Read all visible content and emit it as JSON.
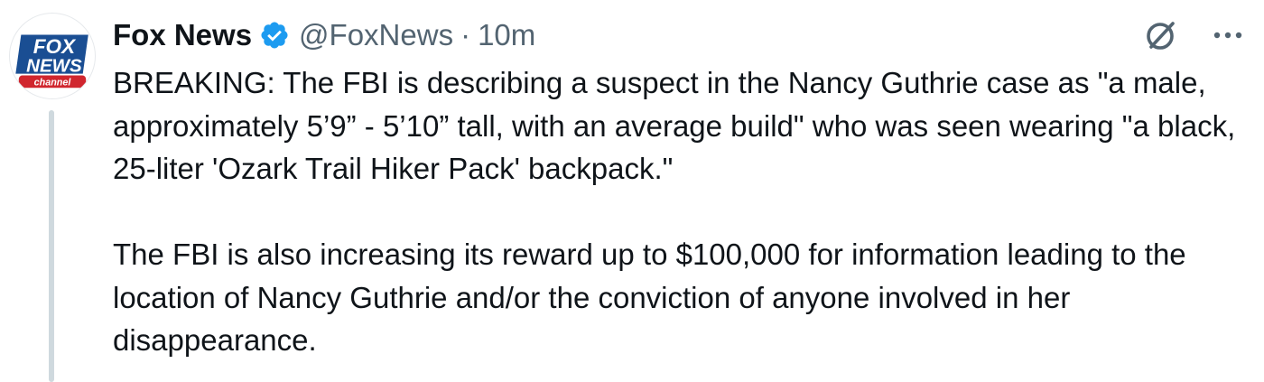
{
  "tweet": {
    "author": {
      "name": "Fox News",
      "handle": "@FoxNews",
      "verified": true,
      "avatar": {
        "brand_top": "FOX",
        "brand_bottom": "NEWS",
        "brand_sub": "channel",
        "colors": {
          "blue": "#1a4e93",
          "red": "#d0262e",
          "white": "#ffffff"
        }
      }
    },
    "separator": "·",
    "time": "10m",
    "paragraphs": [
      "BREAKING: The FBI is describing a suspect in the Nancy Guthrie case as \"a male, approximately 5’9” - 5’10” tall, with an average build\" who was seen wearing \"a black, 25-liter 'Ozark Trail Hiker Pack' backpack.\"",
      "The FBI is also increasing its reward up to $100,000 for information leading to the location of Nancy Guthrie and/or the conviction of anyone involved in her disappearance."
    ],
    "actions": {
      "grok_icon": "grok-icon",
      "more_icon": "more-icon"
    }
  },
  "colors": {
    "verified_blue": "#1d9bf0",
    "secondary_text": "#536471",
    "primary_text": "#0f1419",
    "thread_line": "#cfd9de"
  }
}
